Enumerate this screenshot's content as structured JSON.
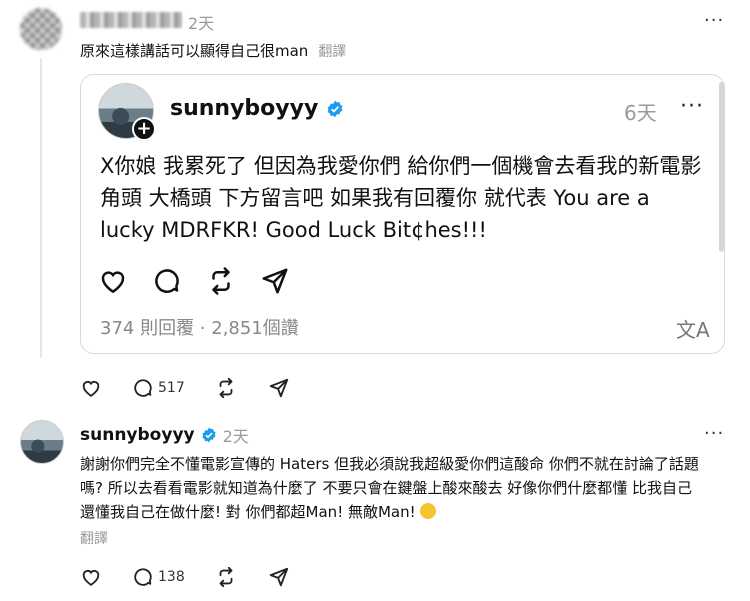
{
  "reply1": {
    "time": "2天",
    "text": "原來這樣講話可以顯得自己很man",
    "translate": "翻譯",
    "more": "···",
    "stats": {
      "likes": "",
      "comments": "517"
    }
  },
  "quote": {
    "username": "sunnyboyyy",
    "time": "6天",
    "more": "···",
    "text": "X你娘 我累死了 但因為我愛你們 給你們一個機會去看我的新電影 角頭 大橋頭 下方留言吧 如果我有回覆你 就代表 You are a lucky MDRFKR! Good Luck Bit¢hes!!!",
    "stats": "374 則回覆 · 2,851個讚"
  },
  "reply2": {
    "username": "sunnyboyyy",
    "time": "2天",
    "more": "···",
    "text": "謝謝你們完全不懂電影宣傳的 Haters 但我必須說我超級愛你們這酸命 你們不就在討論了話題嗎? 所以去看看電影就知道為什麼了 不要只會在鍵盤上酸來酸去 好像你們什麼都懂 比我自己還懂我自己在做什麼! 對 你們都超Man! 無敵Man!",
    "translate": "翻譯",
    "stats": {
      "comments": "138"
    }
  },
  "colors": {
    "verified": "#1d9bf0",
    "muted": "#999999",
    "border": "#d9d9d9"
  }
}
